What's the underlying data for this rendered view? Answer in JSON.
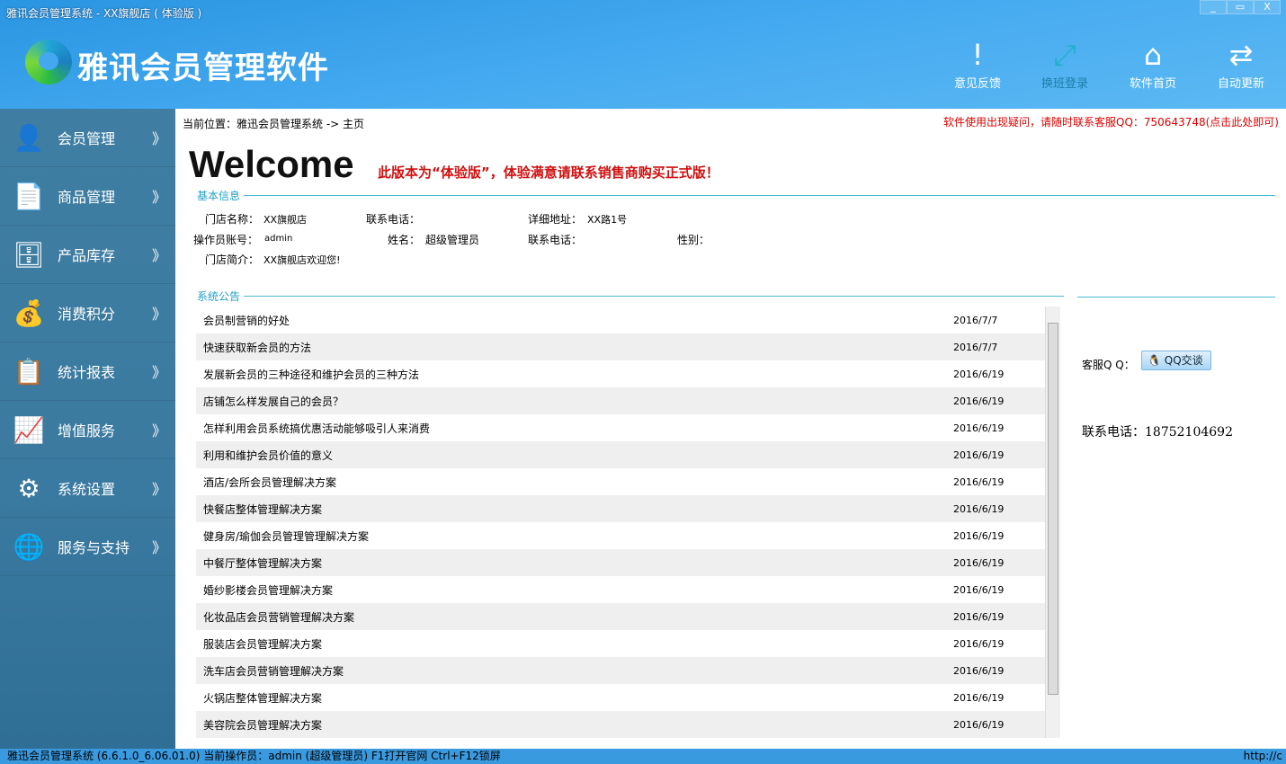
{
  "window": {
    "title": "雅讯会员管理系统 - XX旗舰店 ( 体验版 )",
    "minimize": "_",
    "maximize": "▭",
    "close": "X"
  },
  "header": {
    "app_title": "雅讯会员管理软件",
    "buttons": [
      {
        "label": "意见反馈",
        "icon": "!"
      },
      {
        "label": "换班登录",
        "icon": "⤢"
      },
      {
        "label": "软件首页",
        "icon": "⌂"
      },
      {
        "label": "自动更新",
        "icon": "⇄"
      }
    ]
  },
  "sidebar": {
    "items": [
      {
        "label": "会员管理",
        "icon": "👤"
      },
      {
        "label": "商品管理",
        "icon": "📄"
      },
      {
        "label": "产品库存",
        "icon": "🗄"
      },
      {
        "label": "消费积分",
        "icon": "💰"
      },
      {
        "label": "统计报表",
        "icon": "📋"
      },
      {
        "label": "增值服务",
        "icon": "📈"
      },
      {
        "label": "系统设置",
        "icon": "⚙"
      },
      {
        "label": "服务与支持",
        "icon": "🌐"
      }
    ],
    "chevron": "》"
  },
  "main": {
    "breadcrumb": "当前位置：雅迅会员管理系统 -> 主页",
    "notice": "软件使用出现疑问，请随时联系客服QQ：750643748(点击此处即可)",
    "welcome": "Welcome",
    "trial_notice": "此版本为“体验版”，体验满意请联系销售商购买正式版！",
    "basic_title": "基本信息",
    "basic": {
      "store_name_label": "门店名称：",
      "store_name": "XX旗舰店",
      "phone_label": "联系电话：",
      "address_label": "详细地址：",
      "address": "XX路1号",
      "operator_label": "操作员账号：",
      "operator": "admin",
      "name_label": "姓名：",
      "name": "超级管理员",
      "phone2_label": "联系电话：",
      "gender_label": "性别：",
      "intro_label": "门店简介：",
      "intro": "XX旗舰店欢迎您!"
    },
    "notice_title": "系统公告",
    "announcements": [
      {
        "title": "会员制营销的好处",
        "date": "2016/7/7"
      },
      {
        "title": "快速获取新会员的方法",
        "date": "2016/7/7"
      },
      {
        "title": "发展新会员的三种途径和维护会员的三种方法",
        "date": "2016/6/19"
      },
      {
        "title": "店铺怎么样发展自己的会员？",
        "date": "2016/6/19"
      },
      {
        "title": "怎样利用会员系统搞优惠活动能够吸引人来消费",
        "date": "2016/6/19"
      },
      {
        "title": "利用和维护会员价值的意义",
        "date": "2016/6/19"
      },
      {
        "title": "酒店/会所会员管理解决方案",
        "date": "2016/6/19"
      },
      {
        "title": "快餐店整体管理解决方案",
        "date": "2016/6/19"
      },
      {
        "title": "健身房/瑜伽会员管理管理解决方案",
        "date": "2016/6/19"
      },
      {
        "title": "中餐厅整体管理解决方案",
        "date": "2016/6/19"
      },
      {
        "title": "婚纱影楼会员管理解决方案",
        "date": "2016/6/19"
      },
      {
        "title": "化妆品店会员营销管理解决方案",
        "date": "2016/6/19"
      },
      {
        "title": "服装店会员管理解决方案",
        "date": "2016/6/19"
      },
      {
        "title": "洗车店会员营销管理解决方案",
        "date": "2016/6/19"
      },
      {
        "title": "火锅店整体管理解决方案",
        "date": "2016/6/19"
      },
      {
        "title": "美容院会员管理解决方案",
        "date": "2016/6/19"
      }
    ],
    "qq_label": "客服Q Q：",
    "qq_button": "QQ交谈",
    "contact": "联系电话：18752104692"
  },
  "status": {
    "text": "雅迅会员管理系统 (6.6.1.0_6.06.01.0)  当前操作员：admin (超级管理员)  F1打开官网 Ctrl+F12锁屏",
    "right": "http://c"
  }
}
